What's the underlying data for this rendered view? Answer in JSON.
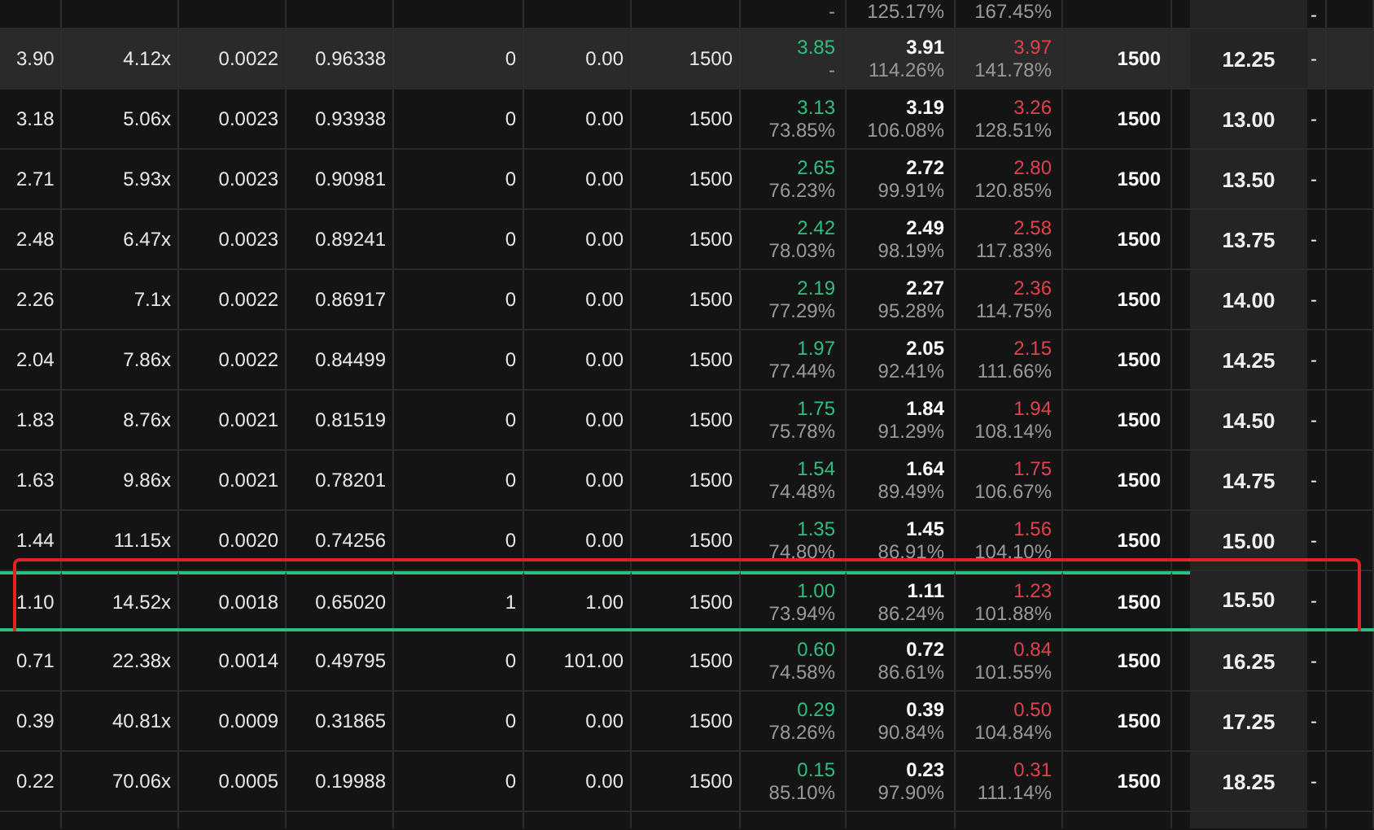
{
  "rows": [
    {
      "bid": {
        "pct": "-"
      },
      "mark": {
        "pct": "125.17%"
      },
      "ask": {
        "pct": "167.45%"
      },
      "trailing": "-",
      "highlighted": false,
      "at_the_money": false,
      "annotated": false
    },
    {
      "values": [
        "3.90",
        "4.12x",
        "0.0022",
        "0.96338",
        "0",
        "0.00",
        "1500"
      ],
      "bid": {
        "price": "3.85",
        "pct": "-"
      },
      "mark": {
        "price": "3.91",
        "pct": "114.26%"
      },
      "ask": {
        "price": "3.97",
        "pct": "141.78%"
      },
      "size": "1500",
      "strike": "12.25",
      "trailing": "-",
      "highlighted": true,
      "at_the_money": false,
      "annotated": false
    },
    {
      "values": [
        "3.18",
        "5.06x",
        "0.0023",
        "0.93938",
        "0",
        "0.00",
        "1500"
      ],
      "bid": {
        "price": "3.13",
        "pct": "73.85%"
      },
      "mark": {
        "price": "3.19",
        "pct": "106.08%"
      },
      "ask": {
        "price": "3.26",
        "pct": "128.51%"
      },
      "size": "1500",
      "strike": "13.00",
      "trailing": "-",
      "highlighted": false,
      "at_the_money": false,
      "annotated": false
    },
    {
      "values": [
        "2.71",
        "5.93x",
        "0.0023",
        "0.90981",
        "0",
        "0.00",
        "1500"
      ],
      "bid": {
        "price": "2.65",
        "pct": "76.23%"
      },
      "mark": {
        "price": "2.72",
        "pct": "99.91%"
      },
      "ask": {
        "price": "2.80",
        "pct": "120.85%"
      },
      "size": "1500",
      "strike": "13.50",
      "trailing": "-",
      "highlighted": false,
      "at_the_money": false,
      "annotated": false
    },
    {
      "values": [
        "2.48",
        "6.47x",
        "0.0023",
        "0.89241",
        "0",
        "0.00",
        "1500"
      ],
      "bid": {
        "price": "2.42",
        "pct": "78.03%"
      },
      "mark": {
        "price": "2.49",
        "pct": "98.19%"
      },
      "ask": {
        "price": "2.58",
        "pct": "117.83%"
      },
      "size": "1500",
      "strike": "13.75",
      "trailing": "-",
      "highlighted": false,
      "at_the_money": false,
      "annotated": false
    },
    {
      "values": [
        "2.26",
        "7.1x",
        "0.0022",
        "0.86917",
        "0",
        "0.00",
        "1500"
      ],
      "bid": {
        "price": "2.19",
        "pct": "77.29%"
      },
      "mark": {
        "price": "2.27",
        "pct": "95.28%"
      },
      "ask": {
        "price": "2.36",
        "pct": "114.75%"
      },
      "size": "1500",
      "strike": "14.00",
      "trailing": "-",
      "highlighted": false,
      "at_the_money": false,
      "annotated": false
    },
    {
      "values": [
        "2.04",
        "7.86x",
        "0.0022",
        "0.84499",
        "0",
        "0.00",
        "1500"
      ],
      "bid": {
        "price": "1.97",
        "pct": "77.44%"
      },
      "mark": {
        "price": "2.05",
        "pct": "92.41%"
      },
      "ask": {
        "price": "2.15",
        "pct": "111.66%"
      },
      "size": "1500",
      "strike": "14.25",
      "trailing": "-",
      "highlighted": false,
      "at_the_money": false,
      "annotated": false
    },
    {
      "values": [
        "1.83",
        "8.76x",
        "0.0021",
        "0.81519",
        "0",
        "0.00",
        "1500"
      ],
      "bid": {
        "price": "1.75",
        "pct": "75.78%"
      },
      "mark": {
        "price": "1.84",
        "pct": "91.29%"
      },
      "ask": {
        "price": "1.94",
        "pct": "108.14%"
      },
      "size": "1500",
      "strike": "14.50",
      "trailing": "-",
      "highlighted": false,
      "at_the_money": false,
      "annotated": false
    },
    {
      "values": [
        "1.63",
        "9.86x",
        "0.0021",
        "0.78201",
        "0",
        "0.00",
        "1500"
      ],
      "bid": {
        "price": "1.54",
        "pct": "74.48%"
      },
      "mark": {
        "price": "1.64",
        "pct": "89.49%"
      },
      "ask": {
        "price": "1.75",
        "pct": "106.67%"
      },
      "size": "1500",
      "strike": "14.75",
      "trailing": "-",
      "highlighted": false,
      "at_the_money": false,
      "annotated": false
    },
    {
      "values": [
        "1.44",
        "11.15x",
        "0.0020",
        "0.74256",
        "0",
        "0.00",
        "1500"
      ],
      "bid": {
        "price": "1.35",
        "pct": "74.80%"
      },
      "mark": {
        "price": "1.45",
        "pct": "86.91%"
      },
      "ask": {
        "price": "1.56",
        "pct": "104.10%"
      },
      "size": "1500",
      "strike": "15.00",
      "trailing": "-",
      "highlighted": false,
      "at_the_money": false,
      "annotated": false
    },
    {
      "values": [
        "1.10",
        "14.52x",
        "0.0018",
        "0.65020",
        "1",
        "1.00",
        "1500"
      ],
      "bid": {
        "price": "1.00",
        "pct": "73.94%"
      },
      "mark": {
        "price": "1.11",
        "pct": "86.24%"
      },
      "ask": {
        "price": "1.23",
        "pct": "101.88%"
      },
      "size": "1500",
      "strike": "15.50",
      "trailing": "-",
      "highlighted": false,
      "at_the_money": true,
      "annotated": true
    },
    {
      "values": [
        "0.71",
        "22.38x",
        "0.0014",
        "0.49795",
        "0",
        "101.00",
        "1500"
      ],
      "bid": {
        "price": "0.60",
        "pct": "74.58%"
      },
      "mark": {
        "price": "0.72",
        "pct": "86.61%"
      },
      "ask": {
        "price": "0.84",
        "pct": "101.55%"
      },
      "size": "1500",
      "strike": "16.25",
      "trailing": "-",
      "highlighted": false,
      "at_the_money": false,
      "annotated": false
    },
    {
      "values": [
        "0.39",
        "40.81x",
        "0.0009",
        "0.31865",
        "0",
        "0.00",
        "1500"
      ],
      "bid": {
        "price": "0.29",
        "pct": "78.26%"
      },
      "mark": {
        "price": "0.39",
        "pct": "90.84%"
      },
      "ask": {
        "price": "0.50",
        "pct": "104.84%"
      },
      "size": "1500",
      "strike": "17.25",
      "trailing": "-",
      "highlighted": false,
      "at_the_money": false,
      "annotated": false
    },
    {
      "values": [
        "0.22",
        "70.06x",
        "0.0005",
        "0.19988",
        "0",
        "0.00",
        "1500"
      ],
      "bid": {
        "price": "0.15",
        "pct": "85.10%"
      },
      "mark": {
        "price": "0.23",
        "pct": "97.90%"
      },
      "ask": {
        "price": "0.31",
        "pct": "111.14%"
      },
      "size": "1500",
      "strike": "18.25",
      "trailing": "-",
      "highlighted": false,
      "at_the_money": false,
      "annotated": false
    }
  ]
}
